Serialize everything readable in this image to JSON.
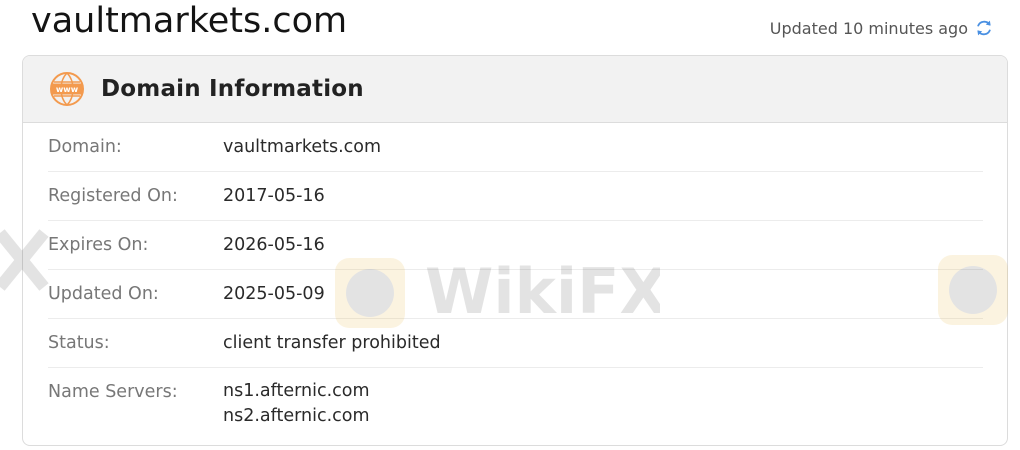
{
  "header": {
    "site_title": "vaultmarkets.com",
    "updated_text": "Updated 10 minutes ago"
  },
  "card": {
    "title": "Domain Information",
    "icon": "www-globe-icon",
    "rows": [
      {
        "label": "Domain:",
        "value": "vaultmarkets.com"
      },
      {
        "label": "Registered On:",
        "value": "2017-05-16"
      },
      {
        "label": "Expires On:",
        "value": "2026-05-16"
      },
      {
        "label": "Updated On:",
        "value": "2025-05-09"
      },
      {
        "label": "Status:",
        "value": "client transfer prohibited"
      },
      {
        "label": "Name Servers:",
        "values": [
          "ns1.afternic.com",
          "ns2.afternic.com"
        ]
      }
    ]
  },
  "watermark": {
    "text": "WikiFX"
  },
  "colors": {
    "accent_orange": "#f39a4e",
    "refresh_blue": "#4a90e2",
    "header_bg": "#f2f2f2"
  }
}
